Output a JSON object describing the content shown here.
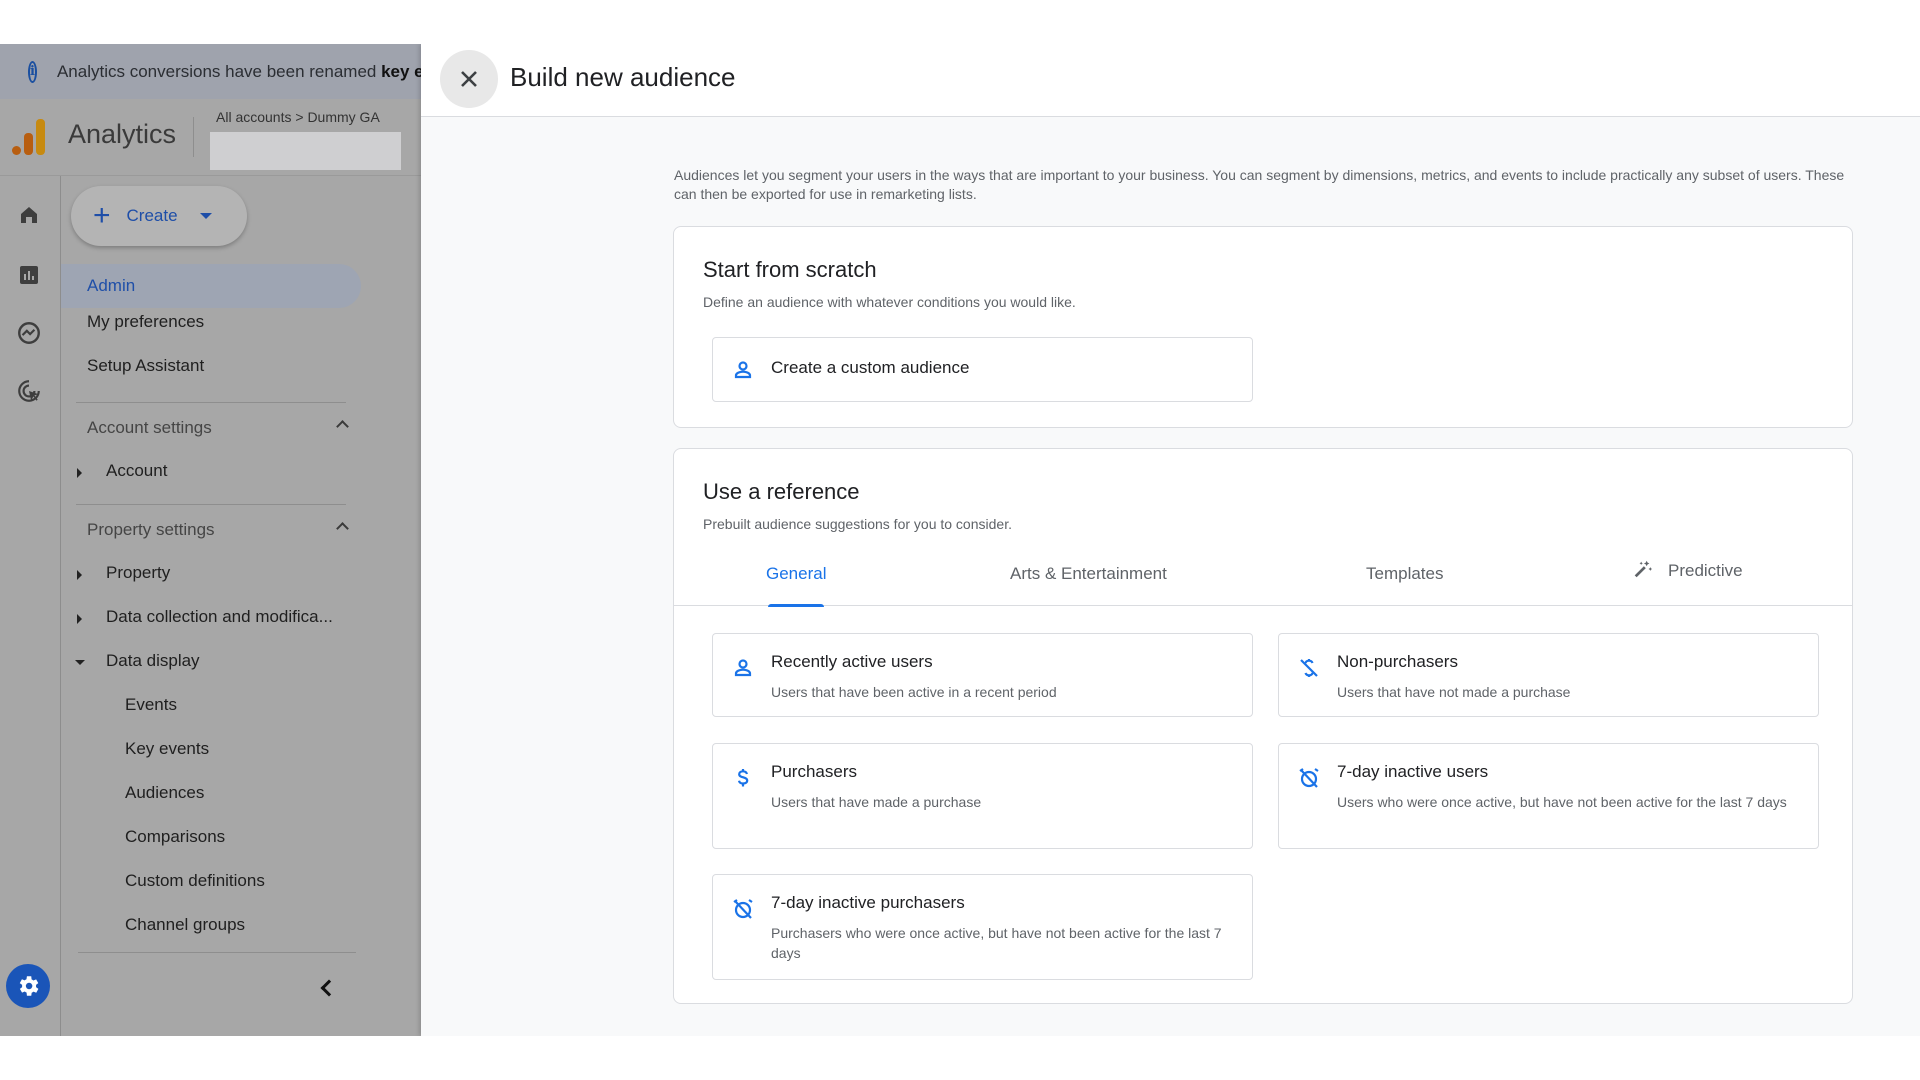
{
  "banner": {
    "icon": "info-icon",
    "text": "Analytics conversions have been renamed ",
    "bold": "key events"
  },
  "appbar": {
    "app_name": "Analytics",
    "breadcrumb": "All accounts > Dummy GA",
    "logo_colors": [
      "#e37400",
      "#f9ab00"
    ]
  },
  "rail": {
    "icons": [
      "home-icon",
      "reports-icon",
      "explore-icon",
      "advertising-icon"
    ],
    "admin_icon": "gear-icon"
  },
  "nav": {
    "create_label": "Create",
    "admin": "Admin",
    "my_preferences": "My preferences",
    "setup_assistant": "Setup Assistant",
    "account_settings": "Account settings",
    "account": "Account",
    "property_settings": "Property settings",
    "property": "Property",
    "data_collection": "Data collection and modifica...",
    "data_display": "Data display",
    "data_display_items": [
      "Events",
      "Key events",
      "Audiences",
      "Comparisons",
      "Custom definitions",
      "Channel groups"
    ]
  },
  "panel": {
    "title": "Build new audience",
    "intro": "Audiences let you segment your users in the ways that are important to your business. You can segment by dimensions, metrics, and events to include practically any subset of users. These can then be exported for use in remarketing lists.",
    "scratch": {
      "title": "Start from scratch",
      "subtitle": "Define an audience with whatever conditions you would like.",
      "button": "Create a custom audience"
    },
    "reference": {
      "title": "Use a reference",
      "subtitle": "Prebuilt audience suggestions for you to consider.",
      "tabs": [
        {
          "label": "General",
          "active": true
        },
        {
          "label": "Arts & Entertainment",
          "active": false
        },
        {
          "label": "Templates",
          "active": false
        },
        {
          "label": "Predictive",
          "active": false,
          "icon": "magic-wand-icon"
        }
      ],
      "audiences": [
        {
          "title": "Recently active users",
          "desc": "Users that have been active in a recent period",
          "icon": "person-icon"
        },
        {
          "title": "Non-purchasers",
          "desc": "Users that have not made a purchase",
          "icon": "money-off-icon"
        },
        {
          "title": "Purchasers",
          "desc": "Users that have made a purchase",
          "icon": "dollar-icon"
        },
        {
          "title": "7-day inactive users",
          "desc": "Users who were once active, but have not been active for the last 7 days",
          "icon": "alarm-off-icon"
        },
        {
          "title": "7-day inactive purchasers",
          "desc": "Purchasers who were once active, but have not been active for the last 7 days",
          "icon": "alarm-off-icon"
        }
      ]
    }
  },
  "colors": {
    "accent": "#1a73e8",
    "admin_blue": "#1a55b8"
  }
}
